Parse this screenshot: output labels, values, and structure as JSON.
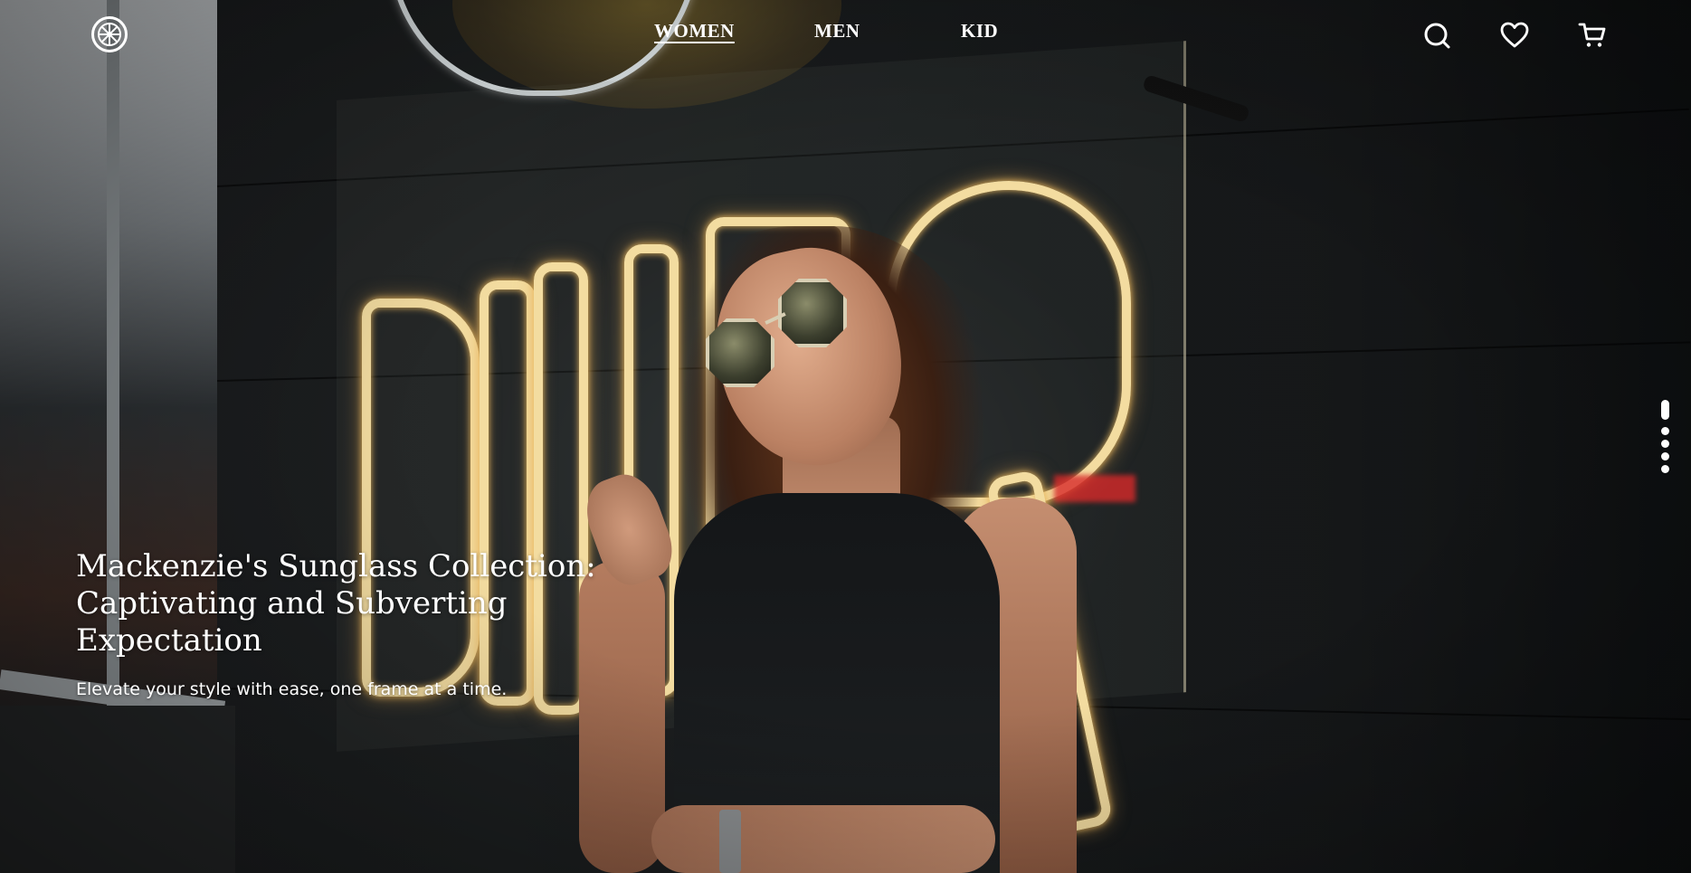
{
  "header": {
    "logo_icon": "lemon-slice-icon",
    "nav": [
      {
        "label": "WOMEN",
        "active": true
      },
      {
        "label": "MEN",
        "active": false
      },
      {
        "label": "KID",
        "active": false
      }
    ],
    "actions": [
      {
        "icon": "search-icon"
      },
      {
        "icon": "heart-icon"
      },
      {
        "icon": "cart-icon"
      }
    ]
  },
  "hero": {
    "title": "Mackenzie's Sunglass Collection: Captivating and Subverting Expectation",
    "subtitle": "Elevate your style with ease, one frame at a time.",
    "slides": {
      "count": 5,
      "current": 1
    }
  },
  "colors": {
    "text": "#ffffff",
    "background": "#1b1d1f",
    "neon": "#f3dca0"
  }
}
